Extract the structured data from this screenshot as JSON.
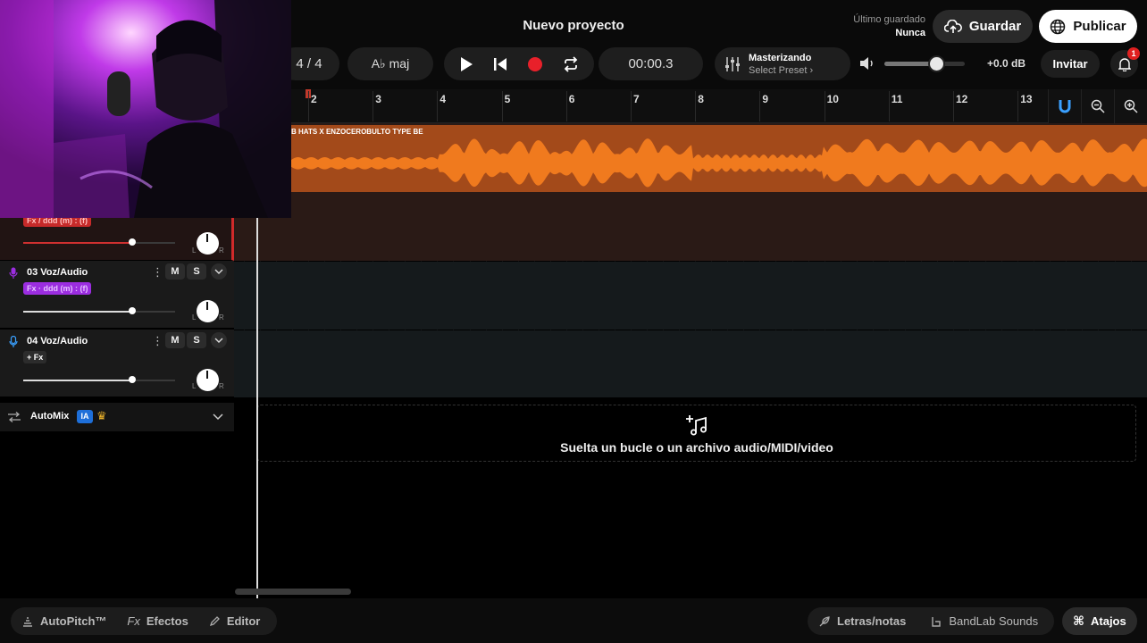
{
  "header": {
    "title": "Nuevo proyecto",
    "last_saved_label": "Último guardado",
    "last_saved_value": "Nunca",
    "save_label": "Guardar",
    "publish_label": "Publicar",
    "time_signature": "4 / 4",
    "key": "A♭ maj",
    "time": "00:00.3",
    "mastering_title": "Masterizando",
    "mastering_preset": "Select Preset ›",
    "volume_db": "+0.0 dB",
    "volume_level": 0.66,
    "invite_label": "Invitar",
    "notification_count": "1"
  },
  "ruler": {
    "bars": [
      "2",
      "3",
      "4",
      "5",
      "6",
      "7",
      "8",
      "9",
      "10",
      "11",
      "12",
      "13"
    ]
  },
  "tracks": [
    {
      "fx_chip": "Fx / ddd (m) : (f)",
      "volume": 0.72
    },
    {
      "name": "03 Voz/Audio",
      "fx_chip": "Fx · ddd (m) : (f)",
      "volume": 0.72,
      "mute": "M",
      "solo": "S"
    },
    {
      "name": "04 Voz/Audio",
      "fx_chip": "+ Fx",
      "volume": 0.72,
      "mute": "M",
      "solo": "S"
    }
  ],
  "pan_labels": {
    "l": "L",
    "r": "R"
  },
  "clip": {
    "name": "B HATS X ENZOCEROBULTO TYPE BE",
    "color": "#a34a1a",
    "wave_color": "#f07a1e"
  },
  "automix": {
    "label": "AutoMix",
    "badge": "IA"
  },
  "dropzone": {
    "text": "Suelta un bucle o un archivo audio/MIDI/video"
  },
  "bottom": {
    "autopitch": "AutoPitch™",
    "effects_prefix": "Fx",
    "effects": "Efectos",
    "editor": "Editor",
    "lyrics": "Letras/notas",
    "sounds": "BandLab Sounds",
    "shortcuts": "Atajos"
  },
  "colors": {
    "record": "#e8202a",
    "accent_blue": "#3aa0ff",
    "track_red": "#d02a2a",
    "track_purple": "#9b2de0"
  }
}
